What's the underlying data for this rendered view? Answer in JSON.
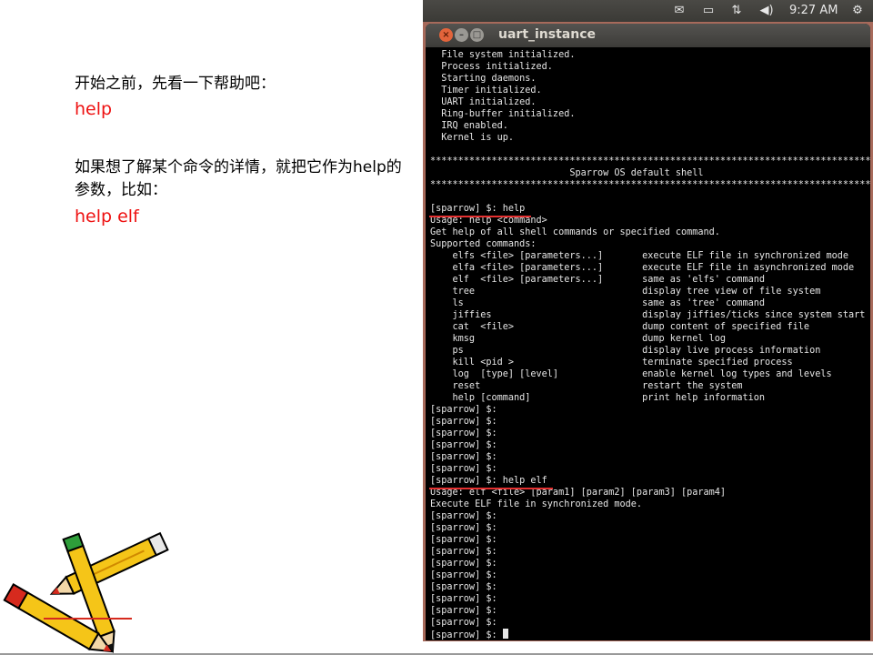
{
  "slide": {
    "text1": "开始之前，先看一下帮助吧：",
    "code1": "help",
    "text2": "如果想了解某个命令的详情，就把它作为help的参数，比如：",
    "code2": "help elf"
  },
  "panel": {
    "icons": [
      "mail-icon",
      "battery-icon",
      "network-icon",
      "volume-icon",
      "settings-gear-icon"
    ],
    "time": "9:27 AM"
  },
  "window": {
    "title": "uart_instance",
    "buttons": {
      "close": "×",
      "minimize": "–",
      "maximize": "□"
    }
  },
  "terminal": {
    "lines": [
      "  File system initialized.",
      "  Process initialized.",
      "  Starting daemons.",
      "  Timer initialized.",
      "  UART initialized.",
      "  Ring-buffer initialized.",
      "  IRQ enabled.",
      "  Kernel is up.",
      "",
      "****************************************************************************************",
      "                         Sparrow OS default shell",
      "****************************************************************************************",
      "",
      "[sparrow] $: help",
      "Usage: help <command>",
      "Get help of all shell commands or specified command.",
      "Supported commands:",
      "    elfs <file> [parameters...]       execute ELF file in synchronized mode",
      "    elfa <file> [parameters...]       execute ELF file in asynchronized mode",
      "    elf  <file> [parameters...]       same as 'elfs' command",
      "    tree                              display tree view of file system",
      "    ls                                same as 'tree' command",
      "    jiffies                           display jiffies/ticks since system start",
      "    cat  <file>                       dump content of specified file",
      "    kmsg                              dump kernel log",
      "    ps                                display live process information",
      "    kill <pid >                       terminate specified process",
      "    log  [type] [level]               enable kernel log types and levels",
      "    reset                             restart the system",
      "    help [command]                    print help information",
      "[sparrow] $:",
      "[sparrow] $:",
      "[sparrow] $:",
      "[sparrow] $:",
      "[sparrow] $:",
      "[sparrow] $:",
      "[sparrow] $: help elf",
      "Usage: elf <file> [param1] [param2] [param3] [param4]",
      "Execute ELF file in synchronized mode.",
      "[sparrow] $:",
      "[sparrow] $:",
      "[sparrow] $:",
      "[sparrow] $:",
      "[sparrow] $:",
      "[sparrow] $:",
      "[sparrow] $:",
      "[sparrow] $:",
      "[sparrow] $:",
      "[sparrow] $:"
    ],
    "last_prompt": "[sparrow] $: "
  },
  "colors": {
    "accent_red": "#ee1111",
    "terminal_bg": "#000000",
    "desktop": "#a76a5b",
    "close_button": "#e3643b"
  }
}
